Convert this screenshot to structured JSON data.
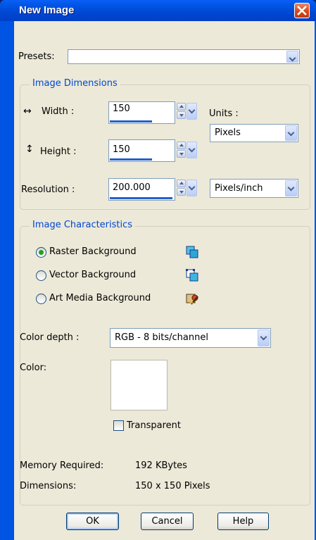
{
  "window": {
    "title": "New Image",
    "close_glyph": "✕"
  },
  "presets": {
    "label": "Presets:",
    "value": ""
  },
  "dimensions": {
    "group_title": "Image Dimensions",
    "width_icon": "↔",
    "width_label": "Width :",
    "width_value": "150",
    "height_icon": "↕",
    "height_label": "Height :",
    "height_value": "150",
    "resolution_label": "Resolution :",
    "resolution_value": "200.000",
    "units_label": "Units :",
    "units_value": "Pixels",
    "resolution_units_value": "Pixels/inch"
  },
  "characteristics": {
    "group_title": "Image Characteristics",
    "backgrounds": [
      {
        "label": "Raster Background",
        "selected": true,
        "icon": "raster-layer-icon"
      },
      {
        "label": "Vector Background",
        "selected": false,
        "icon": "vector-layer-icon"
      },
      {
        "label": "Art Media Background",
        "selected": false,
        "icon": "art-media-layer-icon"
      }
    ],
    "color_depth_label": "Color depth :",
    "color_depth_value": "RGB - 8 bits/channel",
    "color_label": "Color:",
    "color_value": "#ffffff",
    "transparent_label": "Transparent",
    "transparent_checked": false,
    "memory_label": "Memory Required:",
    "memory_value": "192 KBytes",
    "dimensions_label": "Dimensions:",
    "dimensions_value": "150 x 150 Pixels"
  },
  "buttons": {
    "ok": "OK",
    "cancel": "Cancel",
    "help": "Help"
  },
  "colors": {
    "title_blue": "#0054e3",
    "group_title": "#0046d5",
    "dialog_bg": "#ece9d8"
  }
}
